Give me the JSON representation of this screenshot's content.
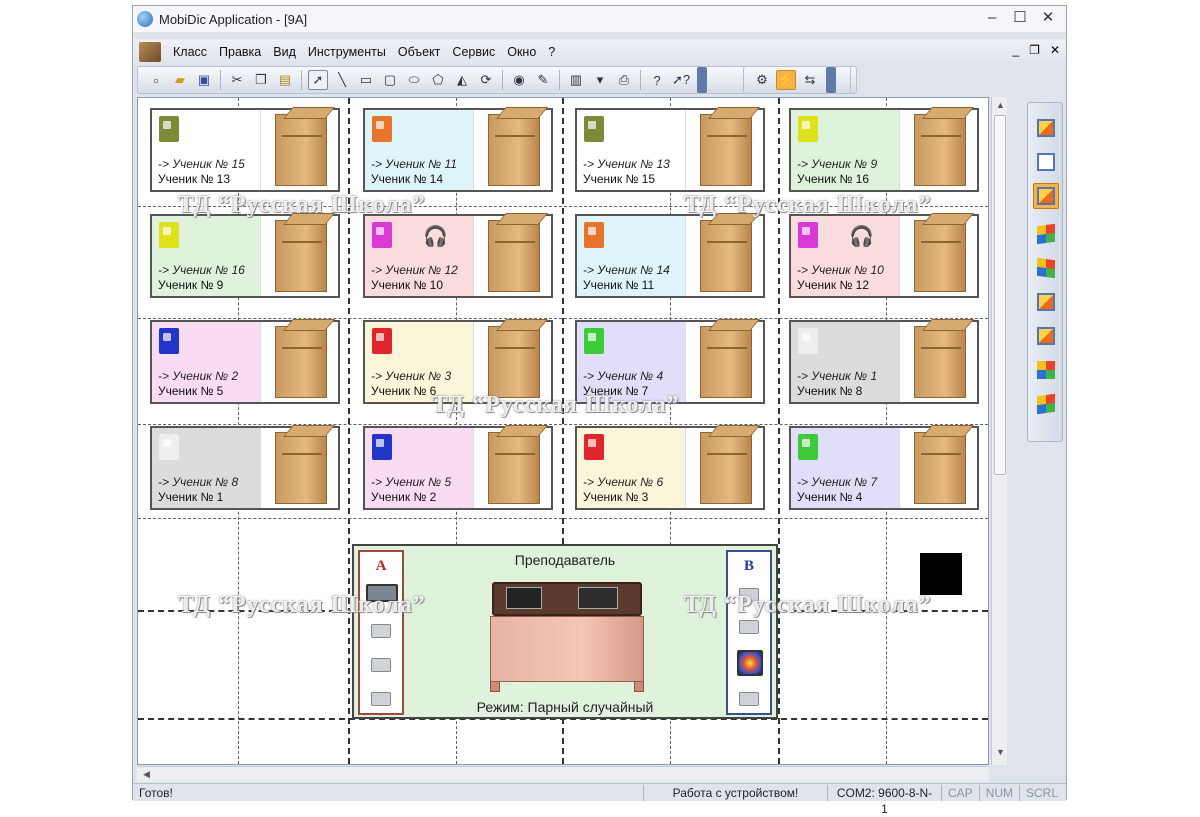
{
  "window": {
    "title": "MobiDic Application - [9А]",
    "controls": [
      "–",
      "☐",
      "✕"
    ],
    "mdi_controls": [
      "_",
      "❐",
      "✕"
    ]
  },
  "menu": [
    "Класс",
    "Правка",
    "Вид",
    "Инструменты",
    "Объект",
    "Сервис",
    "Окно",
    "?"
  ],
  "toolbar": {
    "icons": [
      "new-icon",
      "open-icon",
      "save-icon",
      "cut-icon",
      "copy-icon",
      "paste-icon",
      "pointer-icon",
      "line-icon",
      "rectangle-icon",
      "rounded-rect-icon",
      "ellipse-icon",
      "polygon-icon",
      "fill-shape-icon",
      "rotate-icon",
      "bucket-icon",
      "brush-icon",
      "frame-icon",
      "print-icon",
      "help-icon",
      "context-help-icon"
    ],
    "icons2": [
      "device-icon",
      "lightning-icon",
      "connect-icon"
    ]
  },
  "students": [
    {
      "assign": "-> Ученик № 15",
      "station": "Ученик № 13",
      "bg": "#ffffff",
      "mac": "#7d8a3a",
      "headset": false
    },
    {
      "assign": "-> Ученик № 11",
      "station": "Ученик № 14",
      "bg": "#dff3fa",
      "mac": "#e8732a",
      "headset": false
    },
    {
      "assign": "-> Ученик № 13",
      "station": "Ученик № 15",
      "bg": "#ffffff",
      "mac": "#7d8a3a",
      "headset": false
    },
    {
      "assign": "-> Ученик № 9",
      "station": "Ученик № 16",
      "bg": "#dff2dc",
      "mac": "#dfe21a",
      "headset": false
    },
    {
      "assign": "-> Ученик № 16",
      "station": "Ученик № 9",
      "bg": "#dff2dc",
      "mac": "#dfe21a",
      "headset": false
    },
    {
      "assign": "-> Ученик № 12",
      "station": "Ученик № 10",
      "bg": "#fadcdc",
      "mac": "#d93ad6",
      "headset": true
    },
    {
      "assign": "-> Ученик № 14",
      "station": "Ученик № 11",
      "bg": "#dff3fa",
      "mac": "#e8732a",
      "headset": false
    },
    {
      "assign": "-> Ученик № 10",
      "station": "Ученик № 12",
      "bg": "#fadcdc",
      "mac": "#d93ad6",
      "headset": true
    },
    {
      "assign": "-> Ученик № 2",
      "station": "Ученик № 5",
      "bg": "#f9dcf4",
      "mac": "#2334c8",
      "headset": false
    },
    {
      "assign": "-> Ученик № 3",
      "station": "Ученик № 6",
      "bg": "#fbf6d9",
      "mac": "#e0262a",
      "headset": false
    },
    {
      "assign": "-> Ученик № 4",
      "station": "Ученик № 7",
      "bg": "#e0def8",
      "mac": "#3ecb3a",
      "headset": false
    },
    {
      "assign": "-> Ученик № 1",
      "station": "Ученик № 8",
      "bg": "#dcdcdc",
      "mac": "#eeeeee",
      "headset": false
    },
    {
      "assign": "-> Ученик № 8",
      "station": "Ученик № 1",
      "bg": "#dcdcdc",
      "mac": "#eeeeee",
      "headset": false
    },
    {
      "assign": "-> Ученик № 5",
      "station": "Ученик № 2",
      "bg": "#f9dcf4",
      "mac": "#2334c8",
      "headset": false
    },
    {
      "assign": "-> Ученик № 6",
      "station": "Ученик № 3",
      "bg": "#fbf6d9",
      "mac": "#e0262a",
      "headset": false
    },
    {
      "assign": "-> Ученик № 7",
      "station": "Ученик № 4",
      "bg": "#e0def8",
      "mac": "#3ecb3a",
      "headset": false
    }
  ],
  "teacher": {
    "title": "Преподаватель",
    "mode": "Режим: Парный случайный",
    "panel_a": "А",
    "panel_b": "В"
  },
  "status": {
    "ready": "Готов!",
    "device": "Работа с устройством!",
    "port": "COM2: 9600-8-N-1",
    "cap": "CAP",
    "num": "NUM",
    "scrl": "SCRL"
  },
  "watermark": "ТД “Русская Школа”",
  "colors": {
    "accent": "#f6b24a",
    "frame": "#9aa6b8"
  }
}
